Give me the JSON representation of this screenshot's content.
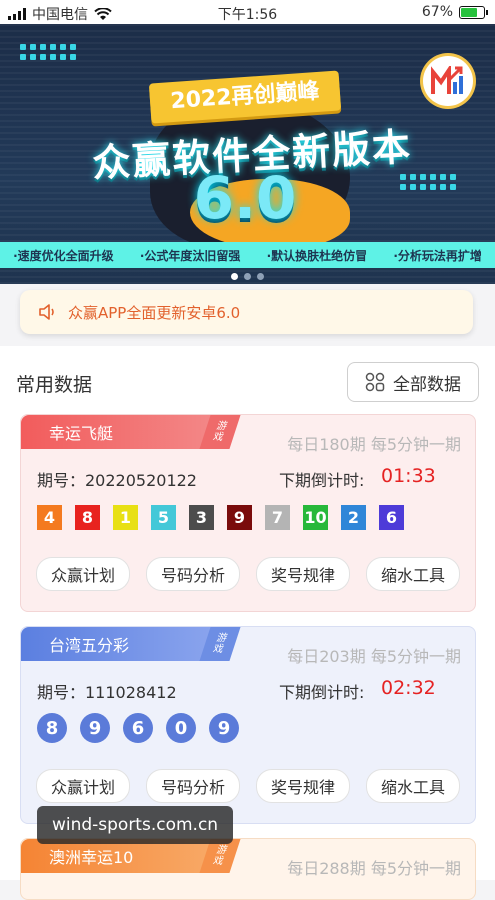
{
  "status_bar": {
    "carrier": "中国电信",
    "time": "下午1:56",
    "battery": "67%",
    "battery_level": 0.67
  },
  "banner": {
    "ribbon": "2022再创巅峰",
    "headline": "众赢软件全新版本",
    "version": "6.0",
    "taglines": [
      "·速度优化全面升级",
      "·公式年度汰旧留强",
      "·默认换肤杜绝仿冒",
      "·分析玩法再扩增"
    ],
    "indicator_count": 3,
    "active_index": 0
  },
  "notice": {
    "text": "众赢APP全面更新安卓6.0"
  },
  "section": {
    "title": "常用数据",
    "all_button": "全部数据"
  },
  "cards": [
    {
      "name": "幸运飞艇",
      "game_tag": [
        "游",
        "戏"
      ],
      "freq": "每日180期 每5分钟一期",
      "issue": "期号：20220520122",
      "countdown_label": "下期倒计时:",
      "countdown": "01:33",
      "balls": [
        {
          "n": "4",
          "color": "#f47a1f"
        },
        {
          "n": "8",
          "color": "#e8231f"
        },
        {
          "n": "1",
          "color": "#e8e014"
        },
        {
          "n": "5",
          "color": "#43c8d8"
        },
        {
          "n": "3",
          "color": "#4c4c4c"
        },
        {
          "n": "9",
          "color": "#7a0b0b"
        },
        {
          "n": "7",
          "color": "#b4b4b4"
        },
        {
          "n": "10",
          "color": "#27b83a"
        },
        {
          "n": "2",
          "color": "#2f86d8"
        },
        {
          "n": "6",
          "color": "#4d3bd8"
        }
      ],
      "buttons": [
        "众赢计划",
        "号码分析",
        "奖号规律",
        "缩水工具"
      ]
    },
    {
      "name": "台湾五分彩",
      "game_tag": [
        "游",
        "戏"
      ],
      "freq": "每日203期 每5分钟一期",
      "issue": "期号：111028412",
      "countdown_label": "下期倒计时:",
      "countdown": "02:32",
      "balls": [
        {
          "n": "8"
        },
        {
          "n": "9"
        },
        {
          "n": "6"
        },
        {
          "n": "0"
        },
        {
          "n": "9"
        }
      ],
      "buttons": [
        "众赢计划",
        "号码分析",
        "奖号规律",
        "缩水工具"
      ]
    },
    {
      "name": "澳洲幸运10",
      "game_tag": [
        "游",
        "戏"
      ],
      "freq": "每日288期 每5分钟一期"
    }
  ],
  "watermark": "wind-sports.com.cn",
  "colors": {
    "accent_red": "#f25c5c",
    "accent_blue": "#5b7fe0",
    "accent_orange": "#f58434",
    "countdown": "#e52222"
  }
}
